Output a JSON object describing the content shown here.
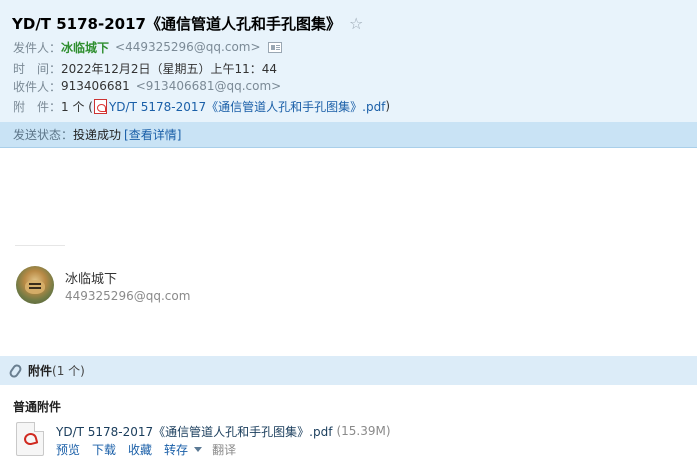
{
  "header": {
    "subject": "YD/T 5178-2017《通信管道人孔和手孔图集》",
    "star_icon": "☆",
    "sender_label": "发件人：",
    "sender_name": "冰临城下",
    "sender_email": "<449325296@qq.com>",
    "time_label": "时　间：",
    "time_value": "2022年12月2日（星期五）上午11：44",
    "recipient_label": "收件人：",
    "recipient_name": "913406681",
    "recipient_email": "<913406681@qq.com>",
    "attach_label": "附　件：",
    "attach_count": "1 个 (",
    "attach_name": "YD/T 5178-2017《通信管道人孔和手孔图集》.pdf",
    "attach_close": ")"
  },
  "status": {
    "label": "发送状态：",
    "value": "投递成功",
    "link": "[查看详情]"
  },
  "signature": {
    "name": "冰临城下",
    "email": "449325296@qq.com"
  },
  "attachments": {
    "title": "附件",
    "count": "(1 个)",
    "section": "普通附件",
    "files": [
      {
        "name": "YD/T 5178-2017《通信管道人孔和手孔图集》.pdf",
        "size": "(15.39M)",
        "actions": {
          "preview": "预览",
          "download": "下载",
          "favorite": "收藏",
          "forward": "转存",
          "translate": "翻译"
        }
      }
    ]
  },
  "colors": {
    "header_bg": "#e8f3fb",
    "status_bg": "#c9e3f5",
    "link": "#1a5fa8",
    "sender": "#2f8f2f"
  }
}
